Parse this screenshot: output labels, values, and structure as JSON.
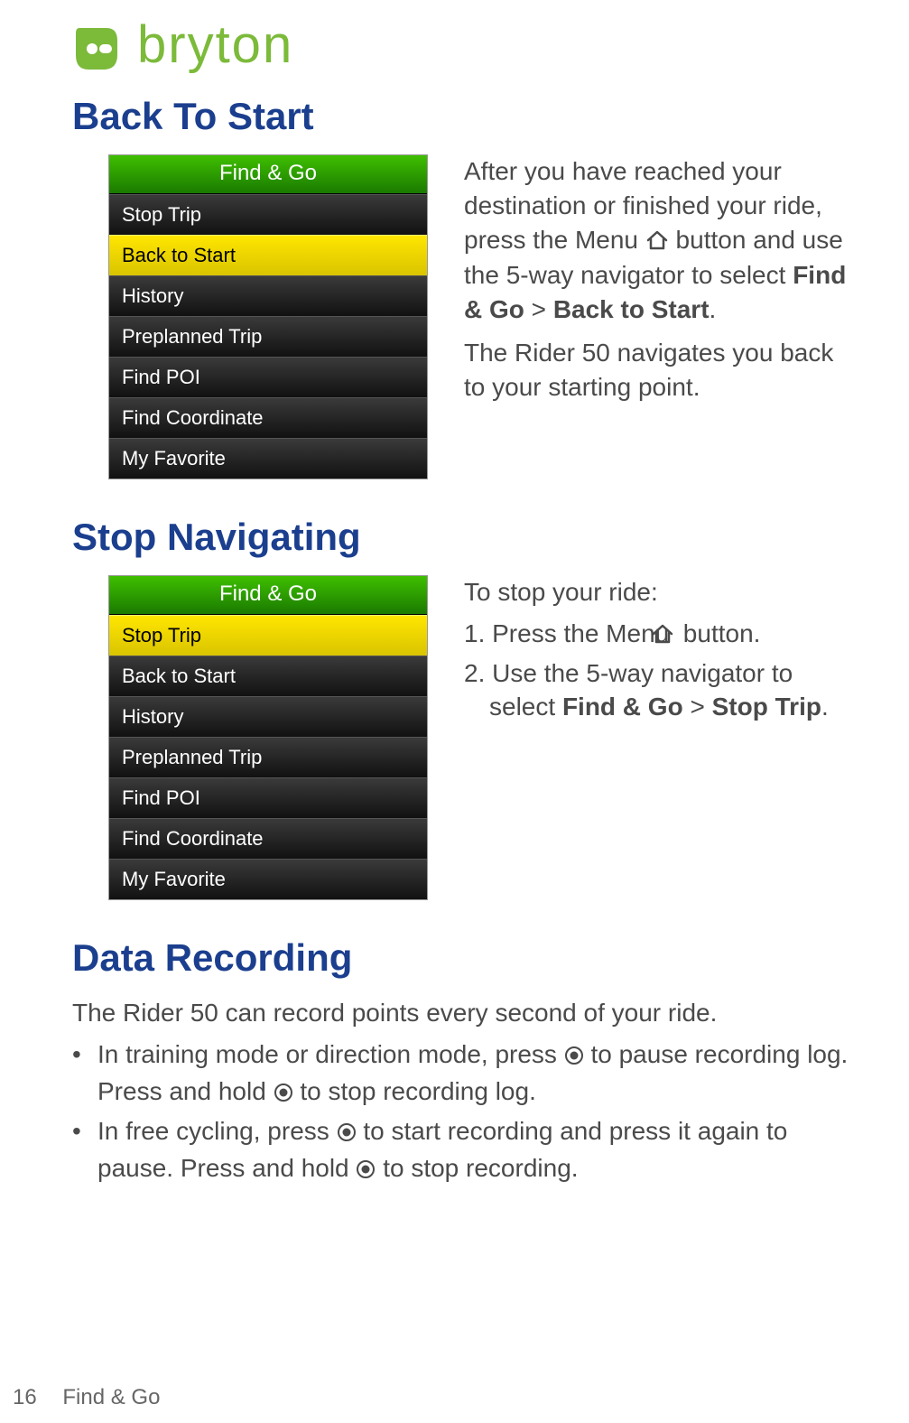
{
  "logo_text": "bryton",
  "sections": {
    "back_to_start": {
      "title": "Back To Start",
      "menu": {
        "header": "Find & Go",
        "items": [
          "Stop Trip",
          "Back to Start",
          "History",
          "Preplanned Trip",
          "Find POI",
          "Find Coordinate",
          "My Favorite"
        ],
        "selected_index": 1
      },
      "para1_a": "After you have reached your destination or finished your ride, press the Menu ",
      "para1_b": " button and use the 5-way navigator to select ",
      "para1_bold1": "Find & Go",
      "para1_gt": " > ",
      "para1_bold2": "Back to Start",
      "para1_end": ".",
      "para2": "The Rider 50 navigates you back to your starting point."
    },
    "stop_nav": {
      "title": "Stop Navigating",
      "menu": {
        "header": "Find & Go",
        "items": [
          "Stop Trip",
          "Back to Start",
          "History",
          "Preplanned Trip",
          "Find POI",
          "Find Coordinate",
          "My Favorite"
        ],
        "selected_index": 0
      },
      "intro": "To stop your ride:",
      "step1_a": "1. Press the Menu ",
      "step1_b": " button.",
      "step2_a": "2. Use the 5-way navigator to select ",
      "step2_bold1": "Find & Go",
      "step2_gt": " > ",
      "step2_bold2": "Stop Trip",
      "step2_end": "."
    },
    "data_rec": {
      "title": "Data Recording",
      "intro": "The Rider 50 can record points every second of your ride.",
      "bullet1_a": "In training mode or direction mode, press ",
      "bullet1_b": " to pause recording log. Press and hold ",
      "bullet1_c": " to stop recording log.",
      "bullet2_a": "In free cycling, press ",
      "bullet2_b": " to start recording and press it again to pause. Press and hold ",
      "bullet2_c": " to stop recording."
    }
  },
  "footer": {
    "page_number": "16",
    "section_name": "Find & Go"
  }
}
